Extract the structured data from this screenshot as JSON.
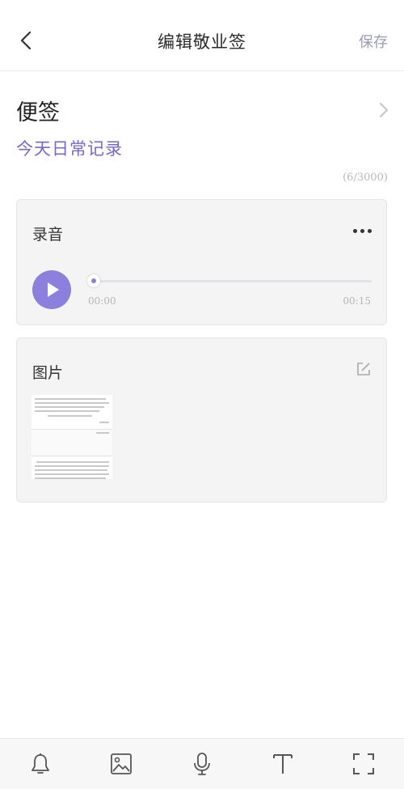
{
  "header": {
    "title": "编辑敬业签",
    "save_label": "保存",
    "back_icon": "chevron-left-icon"
  },
  "category": {
    "label": "便签",
    "icon": "chevron-right-icon"
  },
  "note": {
    "title": "今天日常记录",
    "char_count": "(6/3000)"
  },
  "audio": {
    "title": "录音",
    "current_time": "00:00",
    "total_time": "00:15",
    "progress": 0
  },
  "image": {
    "title": "图片"
  },
  "toolbar": {
    "items": [
      "bell-icon",
      "image-icon",
      "microphone-icon",
      "text-icon",
      "fullscreen-icon"
    ]
  },
  "colors": {
    "accent": "#8b80dd",
    "title_purple": "#7b67c4",
    "save_text": "#9a9ab8"
  }
}
